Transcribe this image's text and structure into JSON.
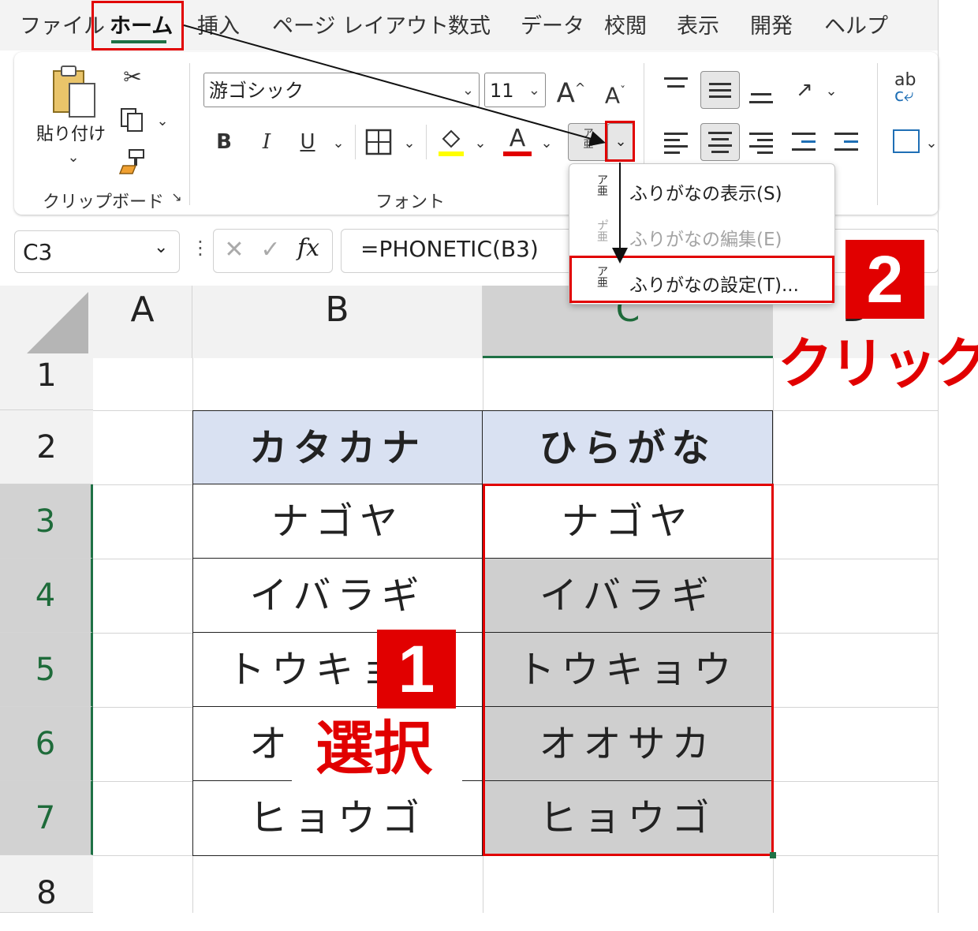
{
  "menu_tabs": [
    "ファイル",
    "ホーム",
    "挿入",
    "ページ レイアウト",
    "数式",
    "データ",
    "校閲",
    "表示",
    "開発",
    "ヘルプ"
  ],
  "ribbon": {
    "clipboard": {
      "paste_label": "貼り付け",
      "group_label": "クリップボード"
    },
    "font": {
      "font_name": "游ゴシック",
      "font_size": "11",
      "grow_label": "A",
      "shrink_label": "A",
      "bold": "B",
      "italic": "I",
      "underline": "U",
      "font_color_letter": "A",
      "group_label": "フォント",
      "highlight_color": "#ffff00",
      "font_color": "#e10000"
    },
    "alignment_wrap": "ab"
  },
  "formula_bar": {
    "name_box": "C3",
    "fx": "fx",
    "formula": "=PHONETIC(B3)"
  },
  "dropdown_menu": {
    "items": [
      {
        "label": "ふりがなの表示(S)",
        "enabled": true
      },
      {
        "label": "ふりがなの編集(E)",
        "enabled": false
      },
      {
        "label": "ふりがなの設定(T)...",
        "enabled": true
      }
    ]
  },
  "sheet": {
    "columns": [
      "A",
      "B",
      "C",
      "D"
    ],
    "rows": [
      "1",
      "2",
      "3",
      "4",
      "5",
      "6",
      "7",
      "8"
    ],
    "selected_column": "C",
    "selected_rows": [
      "3",
      "4",
      "5",
      "6",
      "7"
    ],
    "header_fill": "#d9e1f2",
    "table": {
      "headers": [
        "カタカナ",
        "ひらがな"
      ],
      "rows": [
        [
          "ナゴヤ",
          "ナゴヤ"
        ],
        [
          "イバラギ",
          "イバラギ"
        ],
        [
          "トウキョウ",
          "トウキョウ"
        ],
        [
          "オオサカ",
          "オオサカ"
        ],
        [
          "ヒョウゴ",
          "ヒョウゴ"
        ]
      ]
    }
  },
  "annotations": {
    "step1_number": "1",
    "step1_text": "選択",
    "step2_number": "2",
    "step2_text": "クリック",
    "accent_color": "#e10000"
  }
}
